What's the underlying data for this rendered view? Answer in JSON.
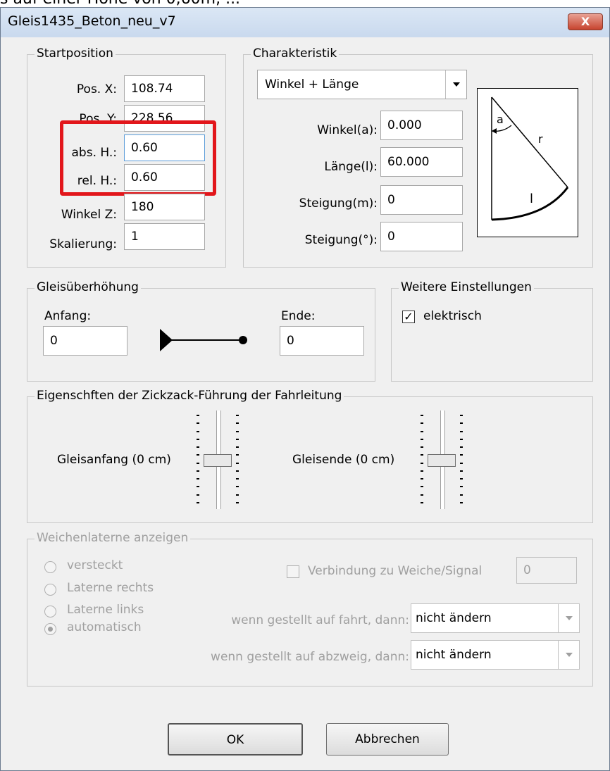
{
  "cut_text": "s auf einer Höhe von 0,60m, ...",
  "window": {
    "title": "Gleis1435_Beton_neu_v7",
    "close_label": "X"
  },
  "startposition": {
    "legend": "Startposition",
    "pos_x_label": "Pos. X:",
    "pos_x_value": "108.74",
    "pos_y_label": "Pos. Y:",
    "pos_y_value": "228.56",
    "abs_h_label": "abs. H.:",
    "abs_h_value": "0.60",
    "rel_h_label": "rel. H.:",
    "rel_h_value": "0.60",
    "winkel_z_label": "Winkel Z:",
    "winkel_z_value": "180",
    "skalierung_label": "Skalierung:",
    "skalierung_value": "1"
  },
  "charakteristik": {
    "legend": "Charakteristik",
    "mode_value": "Winkel + Länge",
    "winkel_label": "Winkel(a):",
    "winkel_value": "0.000",
    "laenge_label": "Länge(l):",
    "laenge_value": "60.000",
    "steigung_m_label": "Steigung(m):",
    "steigung_m_value": "0",
    "steigung_deg_label": "Steigung(°):",
    "steigung_deg_value": "0",
    "diagram_a": "a",
    "diagram_r": "r",
    "diagram_l": "l"
  },
  "gleisueberhoehung": {
    "legend": "Gleisüberhöhung",
    "anfang_label": "Anfang:",
    "anfang_value": "0",
    "ende_label": "Ende:",
    "ende_value": "0"
  },
  "weitere": {
    "legend": "Weitere Einstellungen",
    "elektrisch_label": "elektrisch",
    "elektrisch_checked": true
  },
  "zickzack": {
    "legend": "Eigenschften der Zickzack-Führung der Fahrleitung",
    "gleisanfang_label": "Gleisanfang (0 cm)",
    "gleisende_label": "Gleisende (0 cm)"
  },
  "weichenlaterne": {
    "legend": "Weichenlaterne anzeigen",
    "radio_versteckt": "versteckt",
    "radio_rechts": "Laterne rechts",
    "radio_links": "Laterne links",
    "radio_auto": "automatisch",
    "selected": "automatisch",
    "verbindung_label": "Verbindung zu Weiche/Signal",
    "verbindung_value": "0",
    "fahrt_label": "wenn gestellt auf fahrt, dann:",
    "fahrt_value": "nicht ändern",
    "abzweig_label": "wenn gestellt auf abzweig, dann:",
    "abzweig_value": "nicht ändern"
  },
  "buttons": {
    "ok": "OK",
    "cancel": "Abbrechen"
  }
}
